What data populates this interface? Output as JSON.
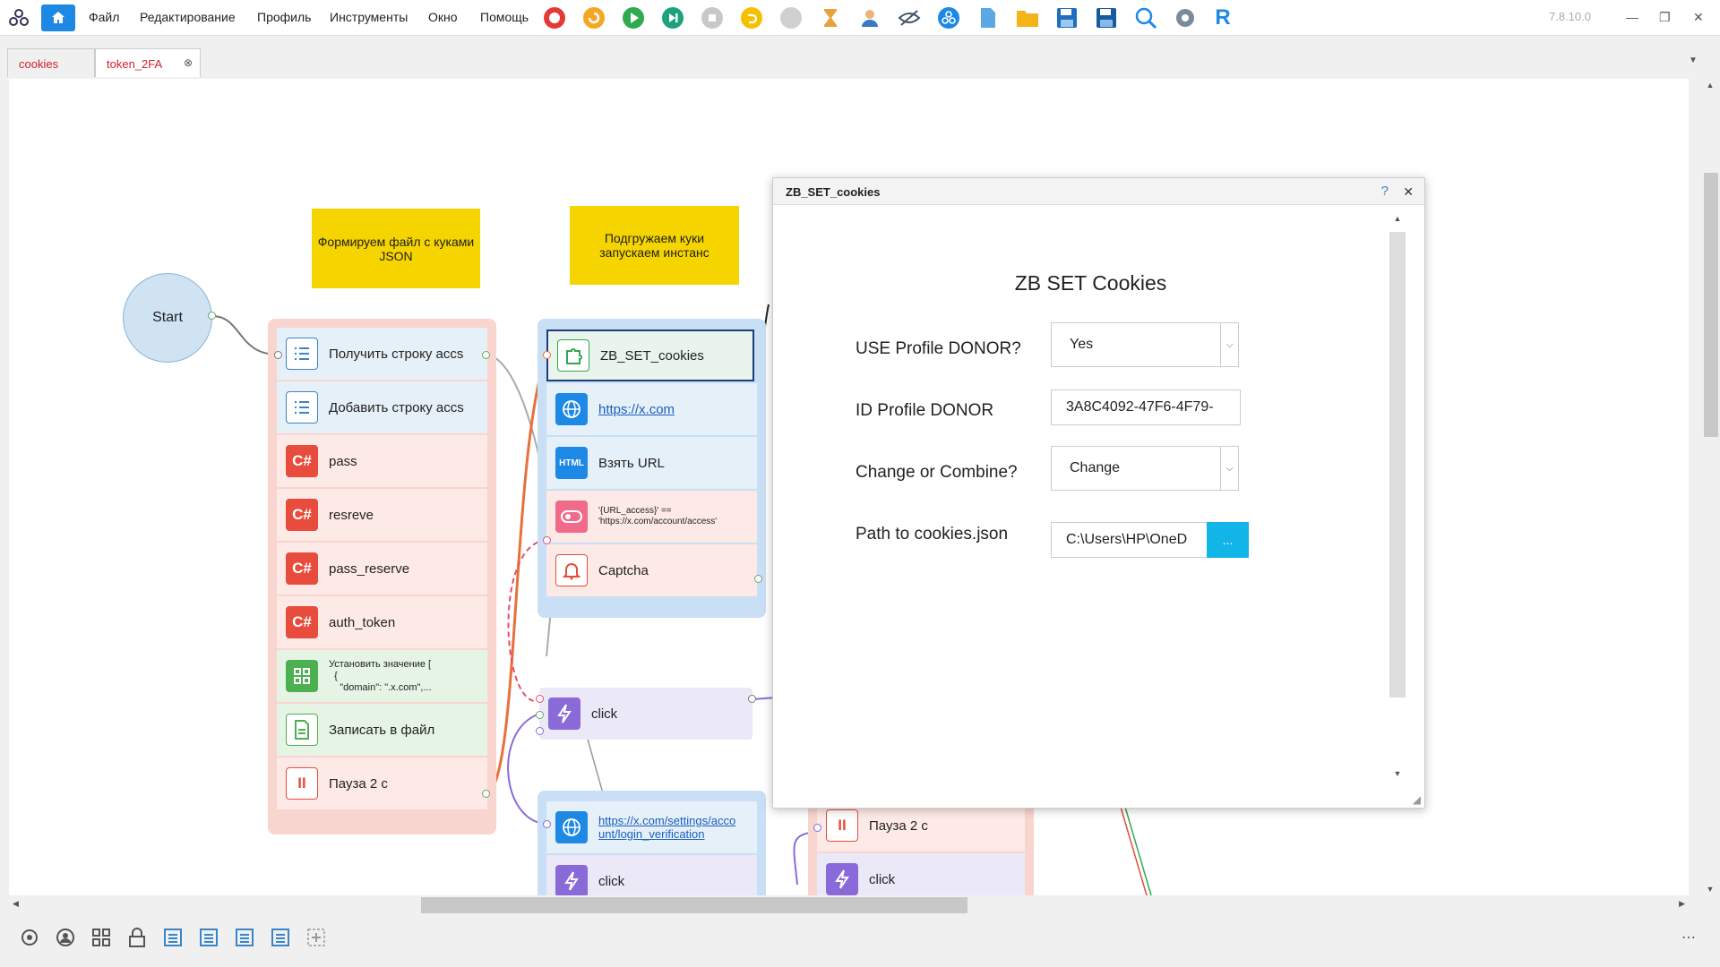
{
  "menu": {
    "items": [
      "Файл",
      "Редактирование",
      "Профиль",
      "Инструменты",
      "Окно",
      "Помощь"
    ],
    "version": "7.8.10.0"
  },
  "tabs": [
    {
      "label": "cookies"
    },
    {
      "label": "token_2FA"
    }
  ],
  "notes": [
    {
      "text": "Формируем файл с куками JSON"
    },
    {
      "text": "Подгружаем куки запускаем инстанс"
    }
  ],
  "start_label": "Start",
  "group1": {
    "rows": [
      {
        "label": "Получить строку accs"
      },
      {
        "label": "Добавить строку accs"
      },
      {
        "label": "pass"
      },
      {
        "label": "resreve"
      },
      {
        "label": "pass_reserve"
      },
      {
        "label": "auth_token"
      },
      {
        "label": "Установить значение [\n  {\n    \"domain\": \".x.com\",..."
      },
      {
        "label": "Записать в файл"
      },
      {
        "label": "Пауза 2 с"
      }
    ]
  },
  "group2": {
    "rows": [
      {
        "label": "ZB_SET_cookies"
      },
      {
        "label": "https://x.com"
      },
      {
        "label": "Взять URL"
      },
      {
        "label": "'{URL_access}' == 'https://x.com/account/access'"
      },
      {
        "label": "Captcha"
      }
    ]
  },
  "click_node": {
    "label": "click"
  },
  "group3": {
    "rows": [
      {
        "label": "https://x.com/settings/account/login_verification"
      },
      {
        "label": "click"
      }
    ]
  },
  "group4": {
    "rows": [
      {
        "label": "Пауза 2 с"
      },
      {
        "label": "click"
      }
    ]
  },
  "dialog": {
    "title": "ZB_SET_cookies",
    "heading": "ZB SET Cookies",
    "fields": [
      {
        "label": "USE Profile DONOR?",
        "value": "Yes"
      },
      {
        "label": "ID Profile DONOR",
        "value": "3A8C4092-47F6-4F79-"
      },
      {
        "label": "Change or Combine?",
        "value": "Change"
      },
      {
        "label": "Path to cookies.json",
        "value": "C:\\Users\\HP\\OneD"
      }
    ],
    "browse_label": "...",
    "help": "?",
    "close": "✕"
  }
}
